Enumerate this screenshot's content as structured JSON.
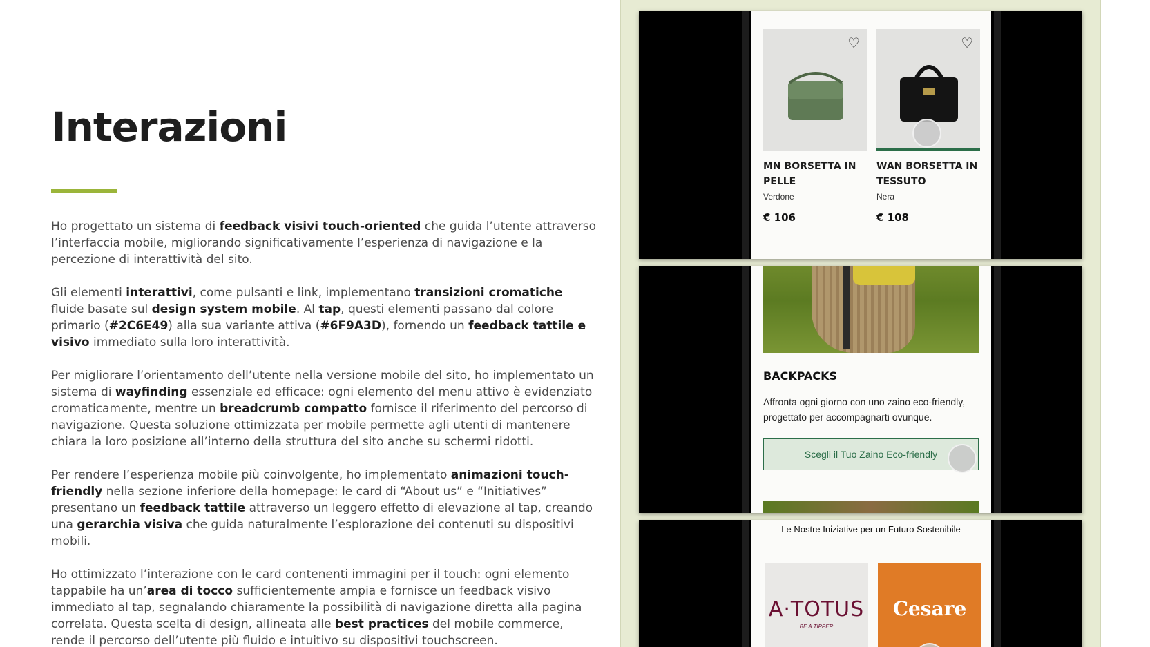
{
  "heading": "Interazioni",
  "paragraphs": [
    [
      {
        "t": "Ho progettato un sistema di ",
        "b": false
      },
      {
        "t": "feedback visivi touch-oriented",
        "b": true
      },
      {
        "t": " che guida l’utente attraverso l’interfaccia mobile, migliorando significativamente l’esperienza di navigazione e la percezione di interattività del sito.",
        "b": false
      }
    ],
    [
      {
        "t": "Gli elementi ",
        "b": false
      },
      {
        "t": "interattivi",
        "b": true
      },
      {
        "t": ", come pulsanti e link, implementano ",
        "b": false
      },
      {
        "t": "transizioni cromatiche",
        "b": true
      },
      {
        "t": " fluide basate sul ",
        "b": false
      },
      {
        "t": "design system mobile",
        "b": true
      },
      {
        "t": ". Al ",
        "b": false
      },
      {
        "t": "tap",
        "b": true
      },
      {
        "t": ", questi elementi passano dal colore primario (",
        "b": false
      },
      {
        "t": "#2C6E49",
        "b": true
      },
      {
        "t": ") alla sua variante attiva (",
        "b": false
      },
      {
        "t": "#6F9A3D",
        "b": true
      },
      {
        "t": "), fornendo un ",
        "b": false
      },
      {
        "t": "feedback tattile e visivo",
        "b": true
      },
      {
        "t": " immediato sulla loro interattività.",
        "b": false
      }
    ],
    [
      {
        "t": "Per migliorare l’orientamento dell’utente nella versione mobile del sito, ho implementato un sistema di ",
        "b": false
      },
      {
        "t": "wayfinding",
        "b": true
      },
      {
        "t": " essenziale ed efficace: ogni elemento del menu attivo è evidenziato cromaticamente, mentre un ",
        "b": false
      },
      {
        "t": "breadcrumb compatto",
        "b": true
      },
      {
        "t": " fornisce il riferimento del percorso di navigazione. Questa soluzione ottimizzata per mobile permette agli utenti di mantenere chiara la loro posizione all’interno della struttura del sito anche su schermi ridotti.",
        "b": false
      }
    ],
    [
      {
        "t": "Per rendere l’esperienza mobile più coinvolgente, ho implementato ",
        "b": false
      },
      {
        "t": "animazioni touch-friendly",
        "b": true
      },
      {
        "t": " nella sezione inferiore della homepage: le card di “About us” e “Initiatives” presentano un ",
        "b": false
      },
      {
        "t": "feedback tattile",
        "b": true
      },
      {
        "t": " attraverso un leggero effetto di elevazione al tap, creando una ",
        "b": false
      },
      {
        "t": "gerarchia visiva",
        "b": true
      },
      {
        "t": " che guida naturalmente l’esplorazione dei contenuti su dispositivi mobili.",
        "b": false
      }
    ],
    [
      {
        "t": "Ho ottimizzato l’interazione con le card contenenti immagini per il touch: ogni elemento tappabile ha un’",
        "b": false
      },
      {
        "t": "area di tocco",
        "b": true
      },
      {
        "t": " sufficientemente ampia e fornisce un feedback visivo immediato al tap, segnalando chiaramente la possibilità di navigazione diretta alla pagina correlata. Questa scelta di design, allineata alle ",
        "b": false
      },
      {
        "t": "best practices",
        "b": true
      },
      {
        "t": " del mobile commerce, rende il percorso dell’utente più fluido e intuitivo su dispositivi touchscreen.",
        "b": false
      }
    ]
  ],
  "colors": {
    "accent_bar": "#9bb53a",
    "primary": "#2C6E49",
    "active": "#6F9A3D",
    "panel_bg": "#e7ebd3"
  },
  "mockup": {
    "products": [
      {
        "name": "MN BORSETTA IN PELLE",
        "color": "Verdone",
        "price": "€ 106",
        "icon": "heart-icon"
      },
      {
        "name": "WAN BORSETTA IN TESSUTO",
        "color": "Nera",
        "price": "€ 108",
        "icon": "heart-icon"
      }
    ],
    "backpacks": {
      "title": "BACKPACKS",
      "text": "Affronta ogni giorno con uno zaino eco-friendly, progettato per accompagnarti ovunque.",
      "cta": "Scegli il Tuo Zaino Eco-friendly"
    },
    "initiatives": {
      "title": "Le Nostre Iniziative per un Futuro Sostenibile",
      "logos": [
        {
          "name": "A·TOTUS",
          "tagline": "BE A TIPPER"
        },
        {
          "name": "Cesare",
          "tagline": ""
        }
      ]
    }
  }
}
